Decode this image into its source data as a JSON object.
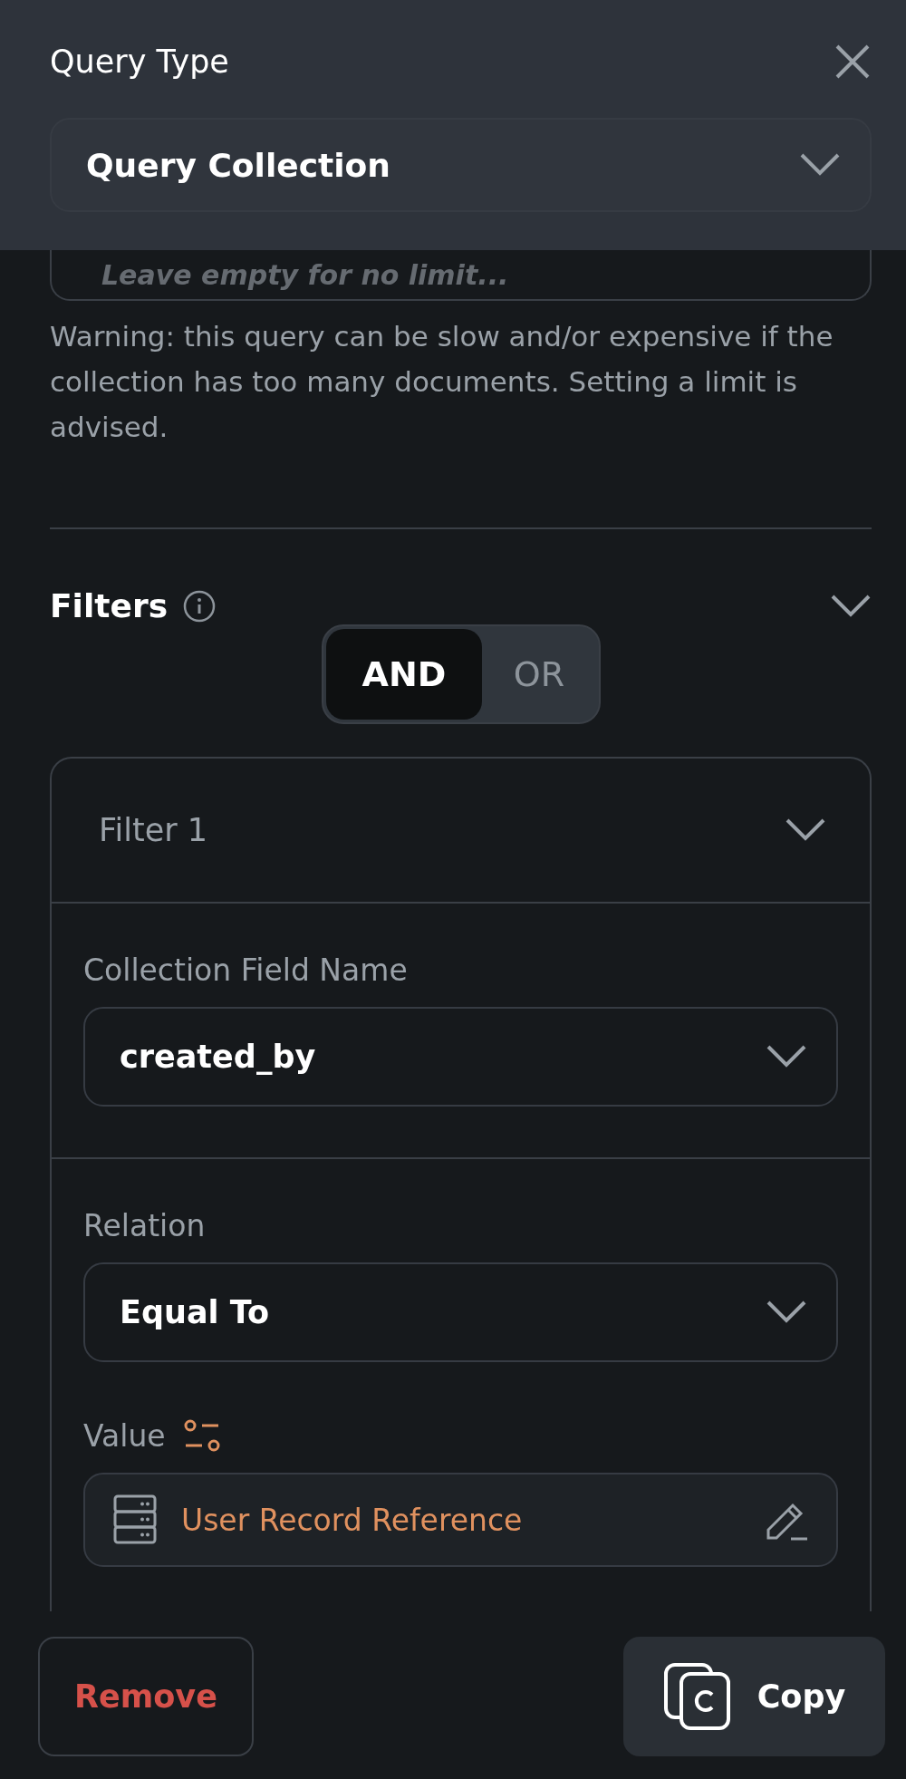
{
  "header": {
    "title": "Query Type",
    "query_type": {
      "value": "Query Collection"
    }
  },
  "limit_field": {
    "placeholder": "Leave empty for no limit..."
  },
  "warning": "Warning: this query can be slow and/or expensive if the collection has too many documents. Setting a limit is advised.",
  "filters": {
    "title": "Filters",
    "expanded": true,
    "logic": [
      {
        "label": "AND",
        "selected": true
      },
      {
        "label": "OR",
        "selected": false
      }
    ],
    "items": [
      {
        "title": "Filter 1",
        "expanded": true,
        "fields": [
          {
            "kind": "dropdown",
            "label": "Collection Field Name",
            "value": "created_by"
          },
          {
            "kind": "dropdown",
            "label": "Relation",
            "value": "Equal To"
          },
          {
            "kind": "value",
            "label": "Value",
            "value": "User Record Reference"
          }
        ]
      }
    ]
  },
  "buttons": [
    {
      "kind": "remove",
      "label": "Remove"
    },
    {
      "kind": "copy",
      "label": "Copy"
    }
  ]
}
